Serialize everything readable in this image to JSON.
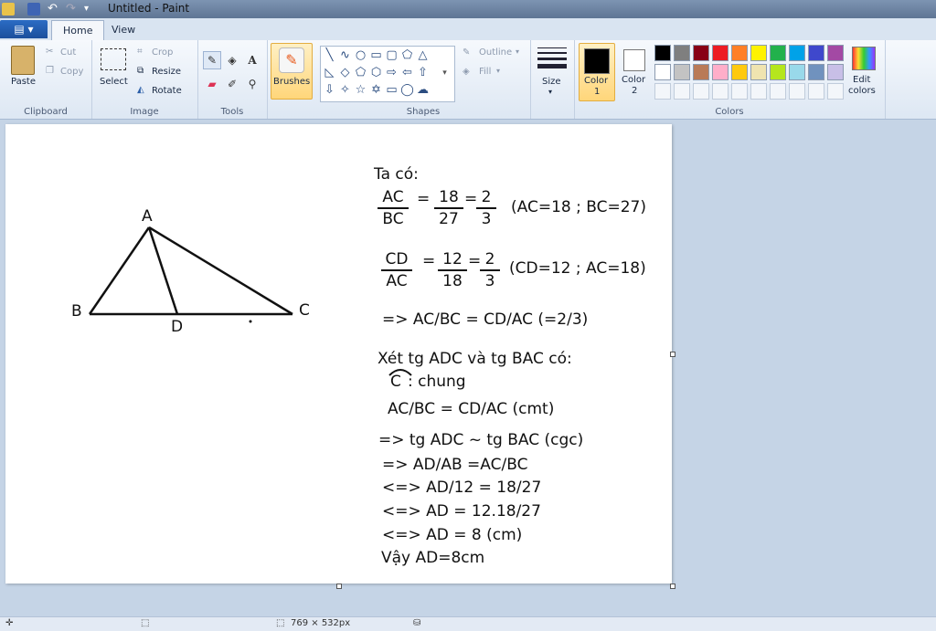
{
  "window": {
    "title": "Untitled - Paint"
  },
  "menu": {
    "file_label": "▤ ▾",
    "tabs": [
      "Home",
      "View"
    ]
  },
  "ribbon": {
    "clipboard": {
      "label": "Clipboard",
      "paste": "Paste",
      "cut": "Cut",
      "copy": "Copy"
    },
    "image": {
      "label": "Image",
      "select": "Select",
      "crop": "Crop",
      "resize": "Resize",
      "rotate": "Rotate"
    },
    "tools": {
      "label": "Tools"
    },
    "brushes": {
      "label": "Brushes"
    },
    "shapes": {
      "label": "Shapes",
      "outline": "Outline",
      "fill": "Fill"
    },
    "size": {
      "label": "Size"
    },
    "colors": {
      "label": "Colors",
      "color1": "Color",
      "color1_num": "1",
      "color2": "Color",
      "color2_num": "2",
      "edit": "Edit",
      "edit2": "colors",
      "palette": [
        "#000000",
        "#7f7f7f",
        "#880015",
        "#ed1c24",
        "#ff7f27",
        "#fff200",
        "#22b14c",
        "#00a2e8",
        "#3f48cc",
        "#a349a4",
        "#ffffff",
        "#c3c3c3",
        "#b97a57",
        "#ffaec9",
        "#ffc90e",
        "#efe4b0",
        "#b5e61d",
        "#99d9ea",
        "#7092be",
        "#c8bfe7"
      ]
    }
  },
  "drawing": {
    "labels": {
      "A": "A",
      "B": "B",
      "C": "C",
      "D": "D"
    },
    "ta_co": "Ta có:",
    "frac1": {
      "n1": "AC",
      "d1": "BC",
      "eq1": "=",
      "n2": "18",
      "d2": "27",
      "eq2": "=",
      "n3": "2",
      "d3": "3",
      "note": "(AC=18 ; BC=27)"
    },
    "frac2": {
      "n1": "CD",
      "d1": "AC",
      "eq1": "=",
      "n2": "12",
      "d2": "18",
      "eq2": "=",
      "n3": "2",
      "d3": "3",
      "note": "(CD=12 ; AC=18)"
    },
    "lines": [
      "=> AC/BC = CD/AC (=2/3)",
      "Xét tg ADC và tg BAC có:",
      "C",
      ": chung",
      "AC/BC = CD/AC (cmt)",
      "=> tg ADC ~ tg BAC (cgc)",
      "=> AD/AB =AC/BC",
      "<=> AD/12 = 18/27",
      "<=> AD = 12.18/27",
      "<=> AD = 8 (cm)",
      "Vậy AD=8cm"
    ]
  },
  "status": {
    "canvas_size": "769 × 532px"
  }
}
